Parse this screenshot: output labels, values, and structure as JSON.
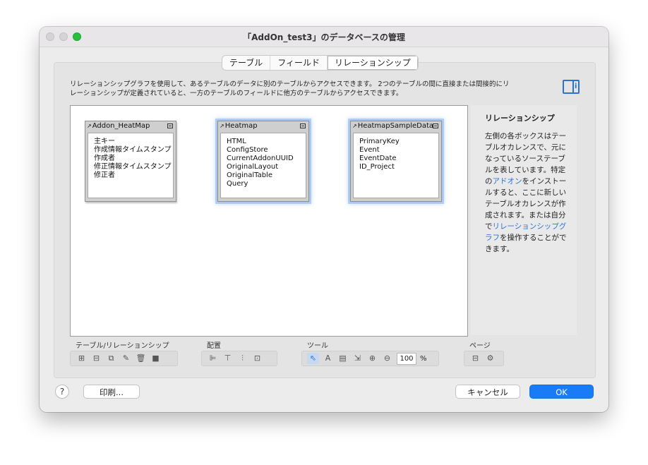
{
  "window": {
    "title": "「AddOn_test3」のデータベースの管理"
  },
  "tabs": [
    {
      "label": "テーブル",
      "active": false
    },
    {
      "label": "フィールド",
      "active": false
    },
    {
      "label": "リレーションシップ",
      "active": true
    }
  ],
  "description": {
    "line1": "リレーションシップグラフを使用して、あるテーブルのデータに別のテーブルからアクセスできます。 2つのテーブルの間に直接または間接的にリ",
    "line2": "レーションシップが定義されていると、一方のテーブルのフィールドに他方のテーブルからアクセスできます。"
  },
  "graph": {
    "tables": [
      {
        "name": "Addon_HeatMap",
        "selected": false,
        "fields": [
          "主キー",
          "作成情報タイムスタンプ",
          "作成者",
          "修正情報タイムスタンプ",
          "修正者"
        ]
      },
      {
        "name": "Heatmap",
        "selected": true,
        "fields": [
          "HTML",
          "ConfigStore",
          "CurrentAddonUUID",
          "OriginalLayout",
          "OriginalTable",
          "Query"
        ]
      },
      {
        "name": "HeatmapSampleData",
        "selected": true,
        "fields": [
          "PrimaryKey",
          "Event",
          "EventDate",
          "ID_Project"
        ]
      }
    ]
  },
  "side_panel": {
    "title": "リレーションシップ",
    "text_part1": "左側の各ボックスはテーブルオカレンスで、元になっているソーステーブルを表しています。特定の",
    "link1": "アドオン",
    "text_part2": "をインストールすると、ここに新しいテーブルオカレンスが作成されます。または自分で",
    "link2": "リレーションシップグラフ",
    "text_part3": "を操作することができます。"
  },
  "toolbar": {
    "group1_label": "テーブル/リレーションシップ",
    "group2_label": "配置",
    "group3_label": "ツール",
    "group4_label": "ページ",
    "zoom_value": "100",
    "zoom_unit": "%"
  },
  "footer": {
    "help_label": "?",
    "print_label": "印刷...",
    "cancel_label": "キャンセル",
    "ok_label": "OK"
  },
  "colors": {
    "accent": "#1a7cf5",
    "link": "#2a73d6",
    "traffic_green": "#27c13f"
  }
}
